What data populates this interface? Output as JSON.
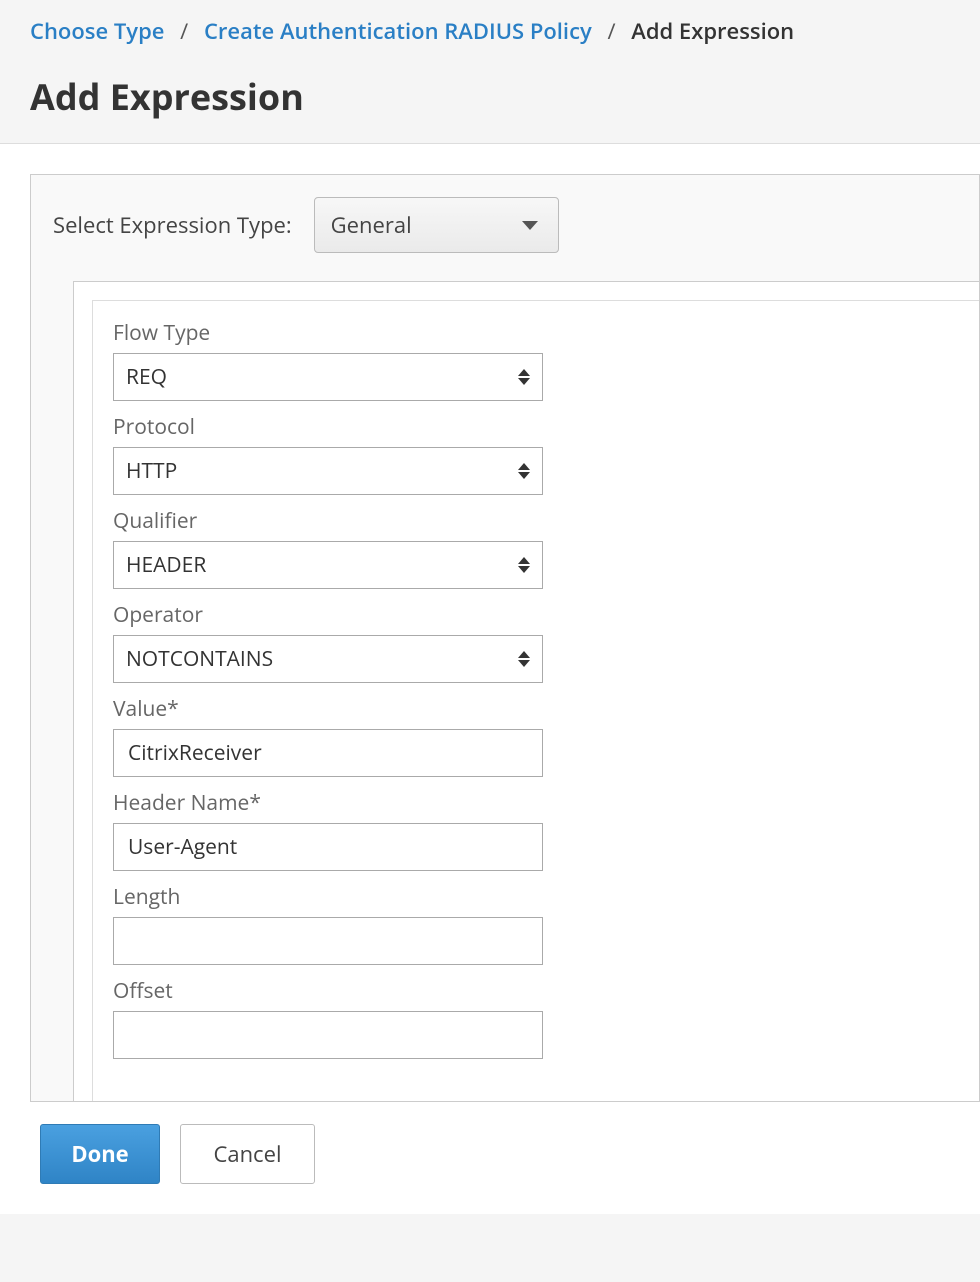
{
  "breadcrumb": {
    "link1": "Choose Type",
    "link2": "Create Authentication RADIUS Policy",
    "current": "Add Expression"
  },
  "page_title": "Add Expression",
  "expr_type": {
    "label": "Select Expression Type:",
    "value": "General"
  },
  "fields": {
    "flow_type": {
      "label": "Flow Type",
      "value": "REQ"
    },
    "protocol": {
      "label": "Protocol",
      "value": "HTTP"
    },
    "qualifier": {
      "label": "Qualifier",
      "value": "HEADER"
    },
    "operator": {
      "label": "Operator",
      "value": "NOTCONTAINS"
    },
    "value": {
      "label": "Value*",
      "value": "CitrixReceiver"
    },
    "header_name": {
      "label": "Header Name*",
      "value": "User-Agent"
    },
    "length": {
      "label": "Length",
      "value": ""
    },
    "offset": {
      "label": "Offset",
      "value": ""
    }
  },
  "buttons": {
    "done": "Done",
    "cancel": "Cancel"
  }
}
